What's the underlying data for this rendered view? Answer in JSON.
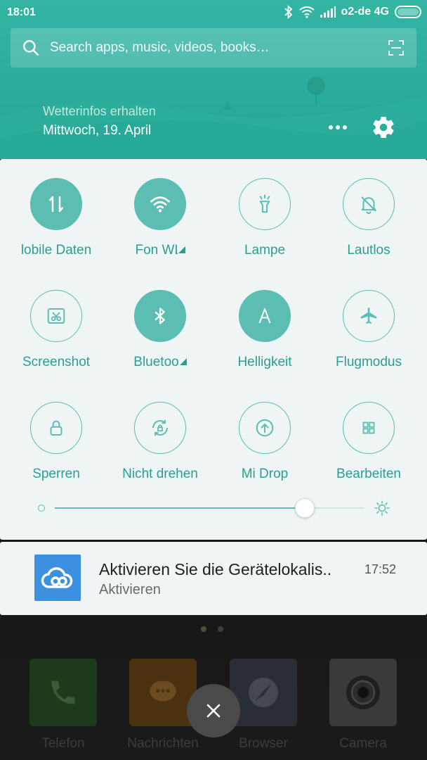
{
  "status_bar": {
    "time": "18:01",
    "carrier": "o2-de 4G",
    "icons": [
      "bluetooth-icon",
      "wifi-icon",
      "signal-icon",
      "battery-icon"
    ]
  },
  "search": {
    "placeholder": "Search apps, music, videos, books…"
  },
  "weather": {
    "label": "Wetterinfos erhalten",
    "date": "Mittwoch, 19. April"
  },
  "toggles": [
    {
      "label": "lobile Daten",
      "icon": "mobile-data-icon",
      "on": true
    },
    {
      "label": "Fon WL",
      "icon": "wifi-icon",
      "on": true,
      "has_menu": true
    },
    {
      "label": "Lampe",
      "icon": "flashlight-icon",
      "on": false
    },
    {
      "label": "Lautlos",
      "icon": "silent-icon",
      "on": false
    },
    {
      "label": "Screenshot",
      "icon": "screenshot-icon",
      "on": false
    },
    {
      "label": "Bluetoo",
      "icon": "bluetooth-icon",
      "on": true,
      "has_menu": true
    },
    {
      "label": "Helligkeit",
      "icon": "brightness-auto-icon",
      "on": true
    },
    {
      "label": "Flugmodus",
      "icon": "airplane-icon",
      "on": false
    },
    {
      "label": "Sperren",
      "icon": "lock-icon",
      "on": false
    },
    {
      "label": "Nicht drehen",
      "icon": "rotation-lock-icon",
      "on": false
    },
    {
      "label": "Mi Drop",
      "icon": "mi-drop-icon",
      "on": false
    },
    {
      "label": "Bearbeiten",
      "icon": "edit-grid-icon",
      "on": false
    }
  ],
  "brightness": {
    "level": 0.81
  },
  "notification": {
    "title": "Aktivieren Sie die Gerätelokalis..",
    "subtitle": "Aktivieren",
    "time": "17:52",
    "icon": "cloud-icon"
  },
  "dock": [
    {
      "label": "Telefon",
      "icon": "phone-icon",
      "color": "#1e3a1c"
    },
    {
      "label": "Nachrichten",
      "icon": "message-icon",
      "color": "#4a3110"
    },
    {
      "label": "Browser",
      "icon": "browser-icon",
      "color": "#2a2d33"
    },
    {
      "label": "Camera",
      "icon": "camera-icon",
      "color": "#3a3a3a"
    }
  ],
  "colors": {
    "accent": "#5cbdb2",
    "header": "#2bac9c",
    "label": "#2a9f91"
  }
}
